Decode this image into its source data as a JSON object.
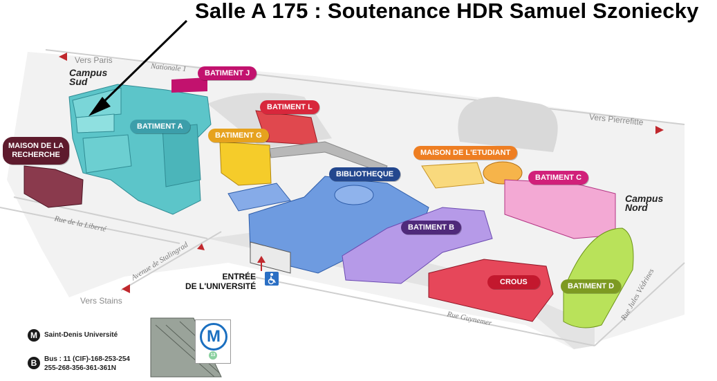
{
  "title": "Salle A 175 : Soutenance HDR Samuel Szoniecky",
  "campus": {
    "sud_line1": "Campus",
    "sud_line2": "Sud",
    "nord_line1": "Campus",
    "nord_line2": "Nord"
  },
  "buildings": {
    "batiment_j": {
      "label": "BATIMENT J",
      "color": "#c2126e"
    },
    "batiment_l": {
      "label": "BATIMENT L",
      "color": "#d8273c"
    },
    "batiment_a": {
      "label": "BATIMENT A",
      "color": "#3c9eaa"
    },
    "batiment_g": {
      "label": "BATIMENT G",
      "color": "#e6a21e"
    },
    "maison_recherche": {
      "label_line1": "MAISON DE LA",
      "label_line2": "RECHERCHE",
      "color": "#5e1b2d"
    },
    "maison_etudiant": {
      "label": "MAISON DE L'ETUDIANT",
      "color": "#ee7e22"
    },
    "bibliotheque": {
      "label": "BIBLIOTHEQUE",
      "color": "#23478e"
    },
    "batiment_c": {
      "label": "BATIMENT C",
      "color": "#d1207a"
    },
    "batiment_b": {
      "label": "BATIMENT B",
      "color": "#4f2a7a"
    },
    "crous": {
      "label": "CROUS",
      "color": "#c3182e"
    },
    "batiment_d": {
      "label": "BATIMENT D",
      "color": "#7d9a22"
    }
  },
  "directions": {
    "vers_paris": "Vers Paris",
    "vers_pierrefitte": "Vers Pierrefitte",
    "vers_stains": "Vers Stains"
  },
  "roads": {
    "nationale": "Nationale 1",
    "liberte": "Rue de la Liberté",
    "stalingrad": "Avenue de Stalingrad",
    "guynemer": "Rue Guynemer",
    "jules_vedrines": "Rue Jules Védrines"
  },
  "entrance": {
    "line1": "ENTRÉE",
    "line2": "DE L'UNIVERSITÉ"
  },
  "legend": {
    "metro_symbol": "M",
    "metro_label": "Saint-Denis Université",
    "bus_symbol": "B",
    "bus_line1": "Bus : 11 (CIF)-168-253-254",
    "bus_line2": "255-268-356-361-361N",
    "metro_logo_letter": "M",
    "metro_logo_sub": "13"
  },
  "icons": [
    "arrow-pointer-icon",
    "direction-arrow-icon",
    "entrance-arrow-icon",
    "wheelchair-icon",
    "metro-icon",
    "bus-icon"
  ]
}
